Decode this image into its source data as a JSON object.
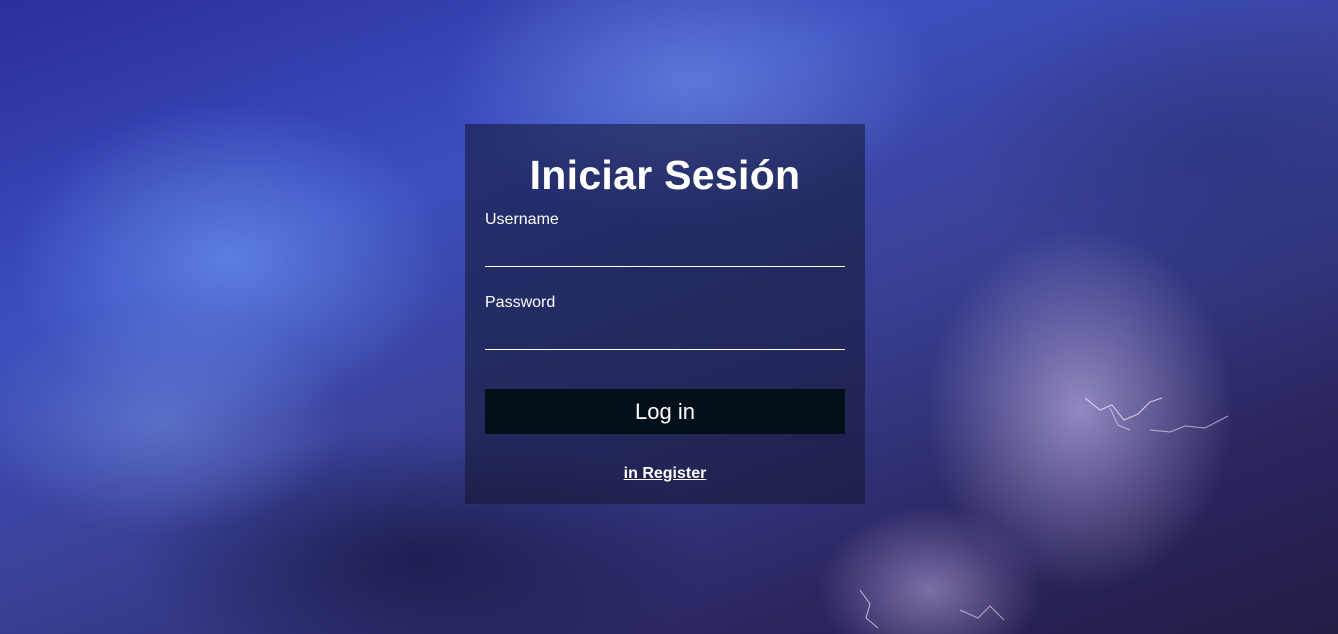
{
  "login": {
    "title": "Iniciar Sesión",
    "username_label": "Username",
    "username_value": "",
    "password_label": "Password",
    "password_value": "",
    "submit_label": "Log in",
    "register_link": "in Register"
  },
  "colors": {
    "card_background": "#12163088",
    "button_background": "#03101a",
    "text": "#ffffff"
  }
}
